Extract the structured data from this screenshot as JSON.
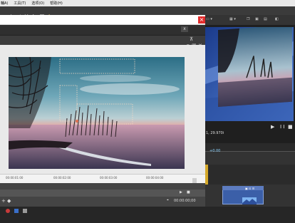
{
  "menu": {
    "items": [
      "輔A)",
      "工具(T)",
      "选项(O)",
      "帮助(H)"
    ]
  },
  "preview": {
    "readout": "1, 29.970i",
    "transport_play": "▶",
    "transport_pause": "❙❙",
    "transport_stop": "■",
    "time_label": "+0.00"
  },
  "dialog": {
    "close_glyph": "×",
    "header_button": "x"
  },
  "ruler": {
    "ticks": [
      "00:00:01:00",
      "00:00:02:00",
      "00:00:03:00",
      "00:00:04:00"
    ]
  },
  "timecode": "00:00:00;00",
  "colors": {
    "close_red": "#e22c2c",
    "clip_blue": "#3b5fa8"
  }
}
